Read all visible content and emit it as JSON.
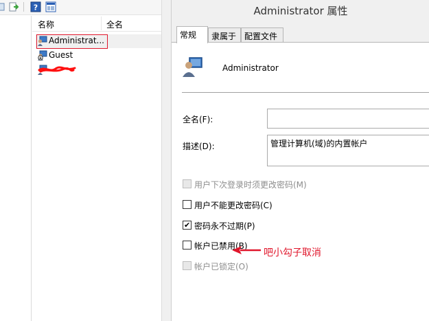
{
  "list": {
    "headers": {
      "name": "名称",
      "fullname": "全名"
    },
    "users": [
      {
        "name": "Administrat..."
      },
      {
        "name": "Guest"
      }
    ]
  },
  "dialog": {
    "title": "Administrator 属性",
    "tabs": [
      {
        "label": "常规"
      },
      {
        "label": "隶属于"
      },
      {
        "label": "配置文件"
      }
    ],
    "username": "Administrator",
    "fields": {
      "fullname_label": "全名(F):",
      "fullname_value": "",
      "description_label": "描述(D):",
      "description_value": "管理计算机(域)的内置帐户"
    },
    "checkboxes": [
      {
        "label": "用户下次登录时须更改密码(M)",
        "checked": false,
        "disabled": true
      },
      {
        "label": "用户不能更改密码(C)",
        "checked": false,
        "disabled": false
      },
      {
        "label": "密码永不过期(P)",
        "checked": true,
        "disabled": false
      },
      {
        "label": "帐户已禁用(B)",
        "checked": false,
        "disabled": false
      },
      {
        "label": "帐户已锁定(O)",
        "checked": false,
        "disabled": true
      }
    ]
  },
  "annotation": {
    "text": "吧小勾子取消",
    "color": "#e0162b"
  }
}
